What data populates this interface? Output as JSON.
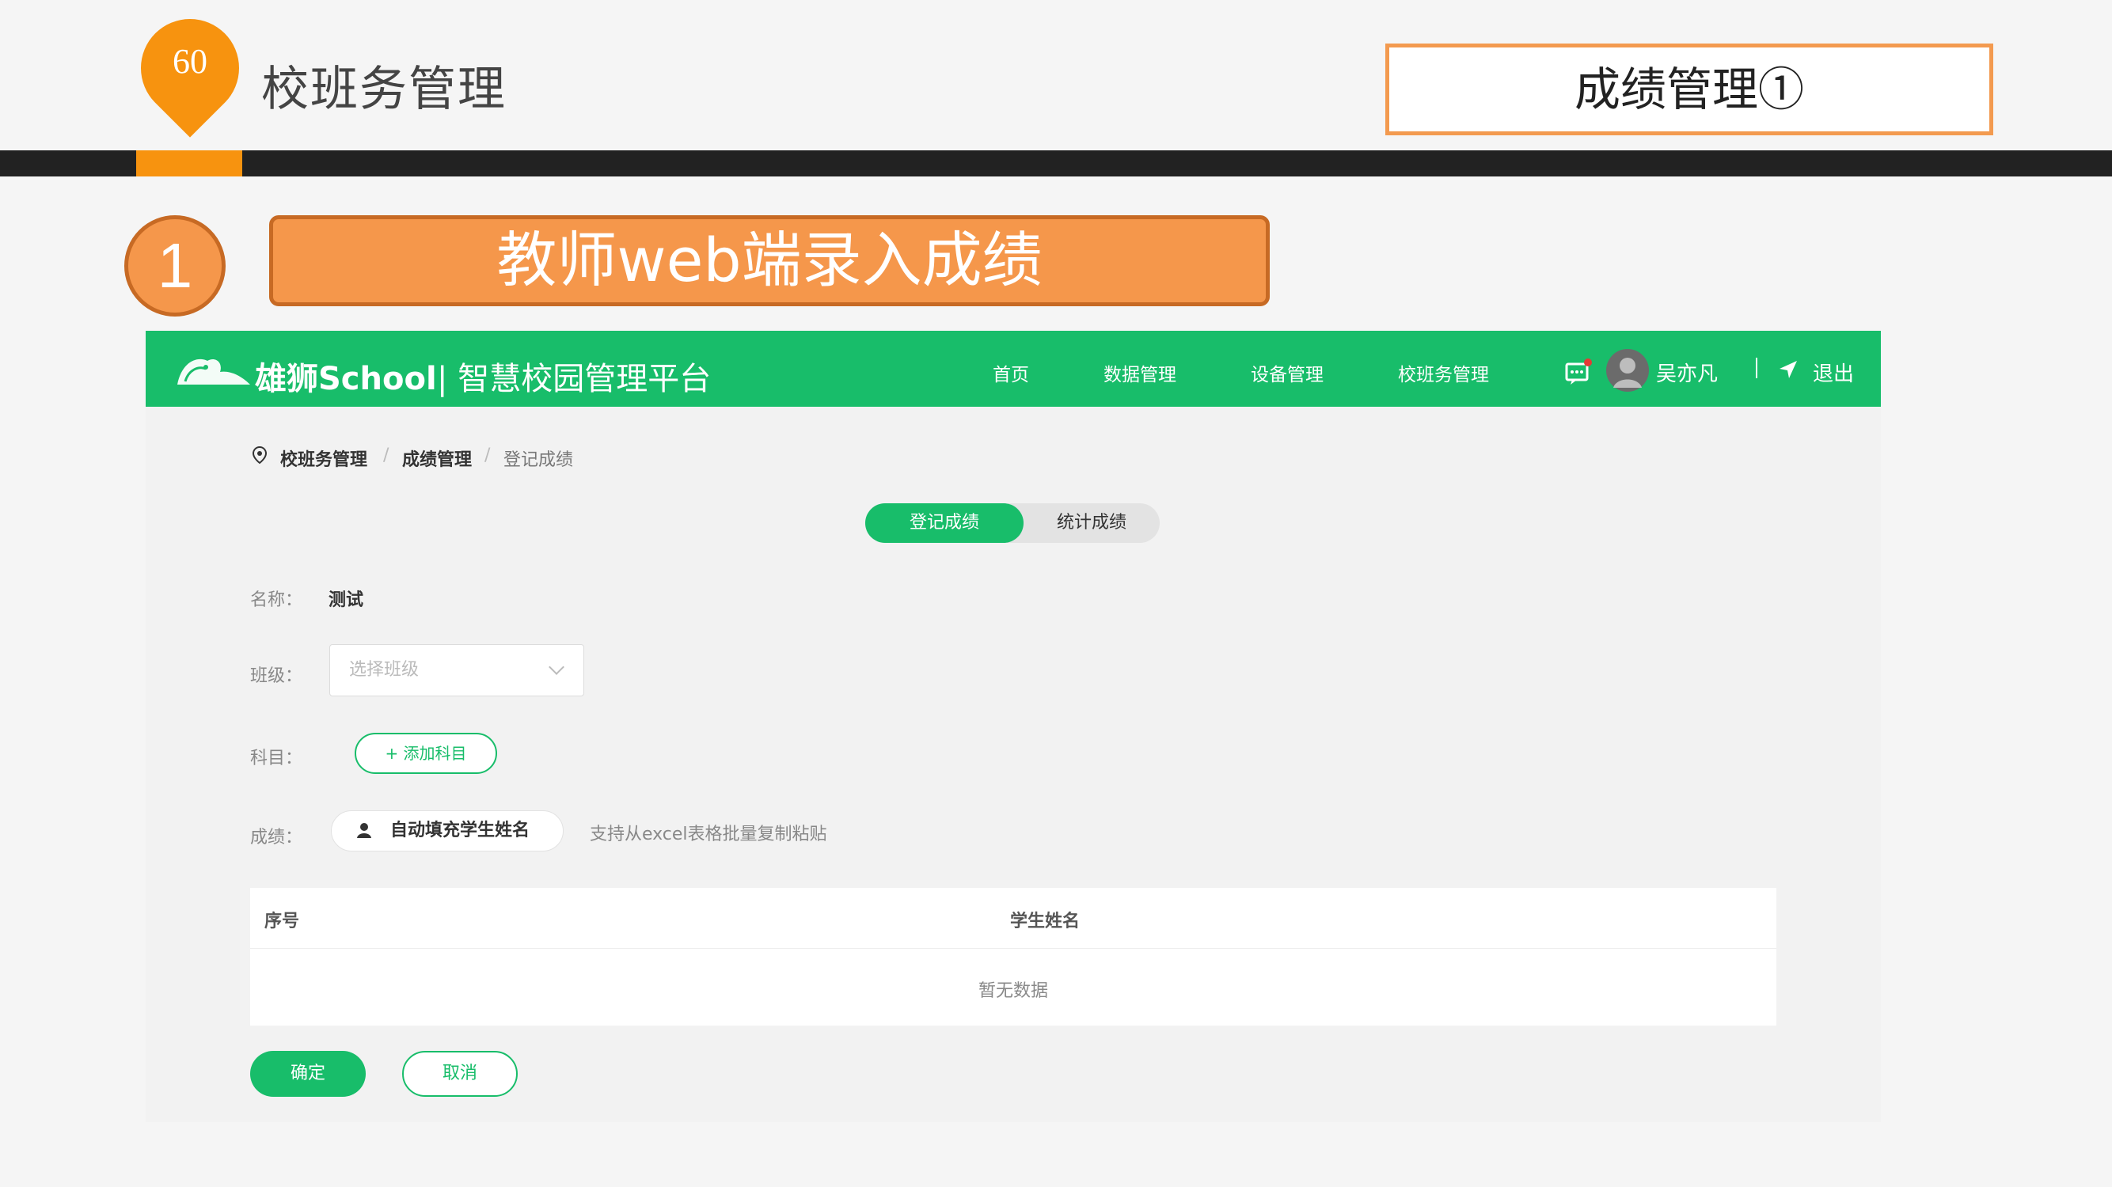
{
  "slide": {
    "page_number": "60",
    "section_title": "校班务管理",
    "topic_title": "成绩管理①"
  },
  "step": {
    "number": "1",
    "title": "教师web端录入成绩"
  },
  "app": {
    "brand": "雄狮School",
    "brand_sub": "| 智慧校园管理平台",
    "nav": [
      "首页",
      "数据管理",
      "设备管理",
      "校班务管理"
    ],
    "user_name": "吴亦凡",
    "logout": "退出",
    "breadcrumb": [
      "校班务管理",
      "成绩管理",
      "登记成绩"
    ],
    "tabs": [
      "登记成绩",
      "统计成绩"
    ],
    "form": {
      "name_label": "名称：",
      "name_value": "测试",
      "class_label": "班级：",
      "class_placeholder": "选择班级",
      "subject_label": "科目：",
      "add_subject": "+ 添加科目",
      "score_label": "成绩：",
      "auto_fill": "自动填充学生姓名",
      "hint": "支持从excel表格批量复制粘贴"
    },
    "table": {
      "headers": [
        "序号",
        "学生姓名"
      ],
      "empty": "暂无数据"
    },
    "buttons": {
      "ok": "确定",
      "cancel": "取消"
    }
  },
  "colors": {
    "accent_orange": "#f7930f",
    "step_orange": "#f5974b",
    "brand_green": "#18bd6a"
  }
}
